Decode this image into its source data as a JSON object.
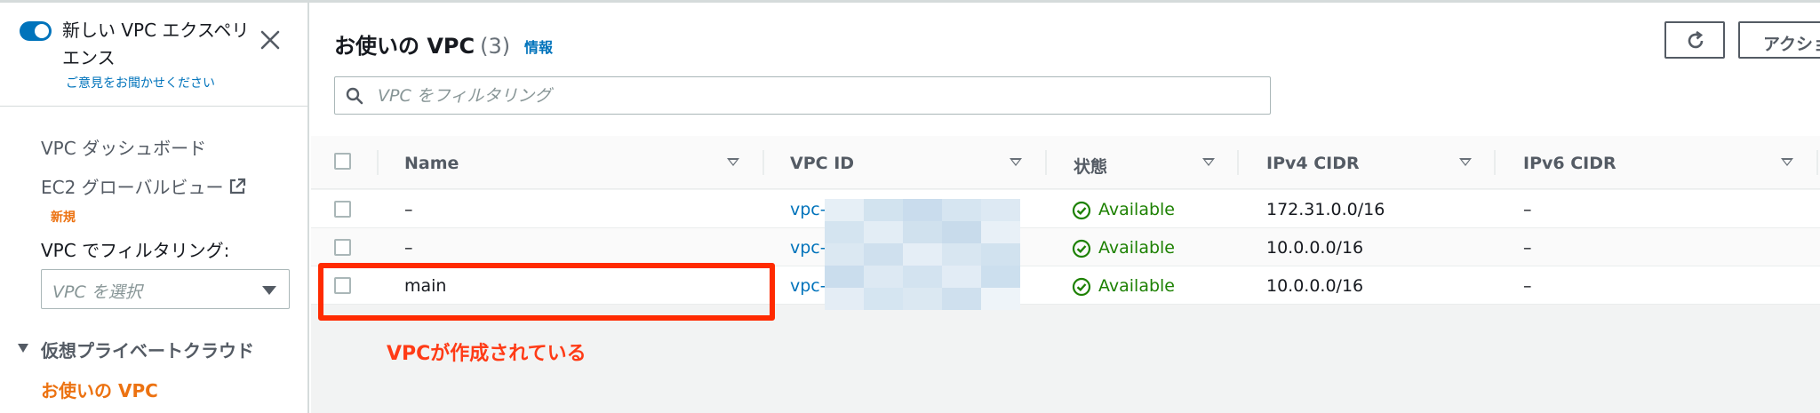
{
  "sidebar": {
    "experience_title": "新しい VPC エクスペリエンス",
    "feedback_link": "ご意見をお聞かせください",
    "nav_dashboard": "VPC ダッシュボード",
    "nav_ec2_global": "EC2 グローバルビュー",
    "new_badge": "新規",
    "filter_label": "VPC でフィルタリング:",
    "select_placeholder": "VPC を選択",
    "section_label": "仮想プライベートクラウド",
    "nav_active": "お使いの VPC"
  },
  "main": {
    "title": "お使いの VPC",
    "count": "(3)",
    "info_link": "情報",
    "action_button": "アクション",
    "search_placeholder": "VPC をフィルタリング"
  },
  "table": {
    "columns": [
      "Name",
      "VPC ID",
      "状態",
      "IPv4 CIDR",
      "IPv6 CIDR"
    ],
    "rows": [
      {
        "name": "–",
        "vpc_id": "vpc-0",
        "status": "Available",
        "ipv4": "172.31.0.0/16",
        "ipv6": "–"
      },
      {
        "name": "–",
        "vpc_id": "vpc-0",
        "status": "Available",
        "ipv4": "10.0.0.0/16",
        "ipv6": "–"
      },
      {
        "name": "main",
        "vpc_id": "vpc-0",
        "status": "Available",
        "ipv4": "10.0.0.0/16",
        "ipv6": "–"
      }
    ]
  },
  "annotation": "VPCが作成されている",
  "colors": {
    "accent": "#0073bb",
    "nav_active": "#ec7211",
    "status_ok": "#1d8102",
    "highlight": "#ff2a00"
  }
}
